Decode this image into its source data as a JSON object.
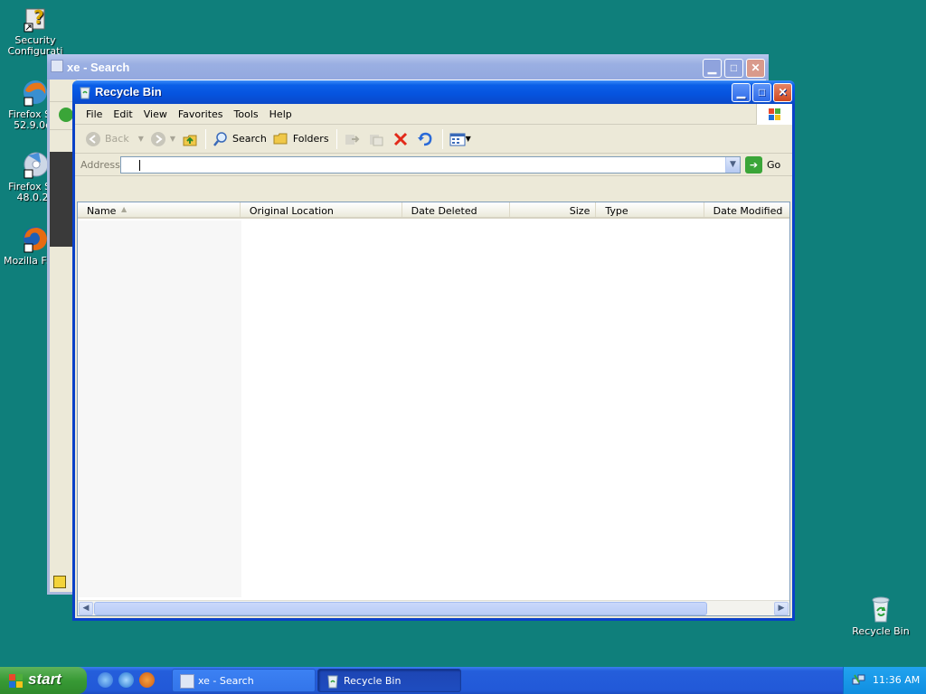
{
  "desktop": {
    "icons": [
      {
        "label": "Security Configurati",
        "icon": "security-config-icon"
      },
      {
        "label": "Firefox Se 52.9.0e",
        "icon": "firefox-setup-icon"
      },
      {
        "label": "Firefox Se 48.0.2",
        "icon": "firefox-setup-cd-icon"
      },
      {
        "label": "Mozilla Fir",
        "icon": "firefox-icon"
      },
      {
        "label": "Recycle Bin",
        "icon": "recycle-bin-icon"
      }
    ]
  },
  "background_window": {
    "title": "xe - Search"
  },
  "window": {
    "title": "Recycle Bin",
    "menu": [
      "File",
      "Edit",
      "View",
      "Favorites",
      "Tools",
      "Help"
    ],
    "toolbar": {
      "back": "Back",
      "search": "Search",
      "folders": "Folders"
    },
    "address": {
      "label": "Address",
      "value": "",
      "go": "Go"
    },
    "columns": [
      "Name",
      "Original Location",
      "Date Deleted",
      "Size",
      "Type",
      "Date Modified"
    ],
    "sort_column": "Name"
  },
  "taskbar": {
    "start": "start",
    "tasks": [
      {
        "label": "xe - Search",
        "active": false
      },
      {
        "label": "Recycle Bin",
        "active": true
      }
    ],
    "clock": "11:36 AM"
  },
  "colors": {
    "desktop": "#0f7f7b",
    "titlebar": "#0653de",
    "taskbar": "#245edb",
    "start": "#389a35"
  }
}
